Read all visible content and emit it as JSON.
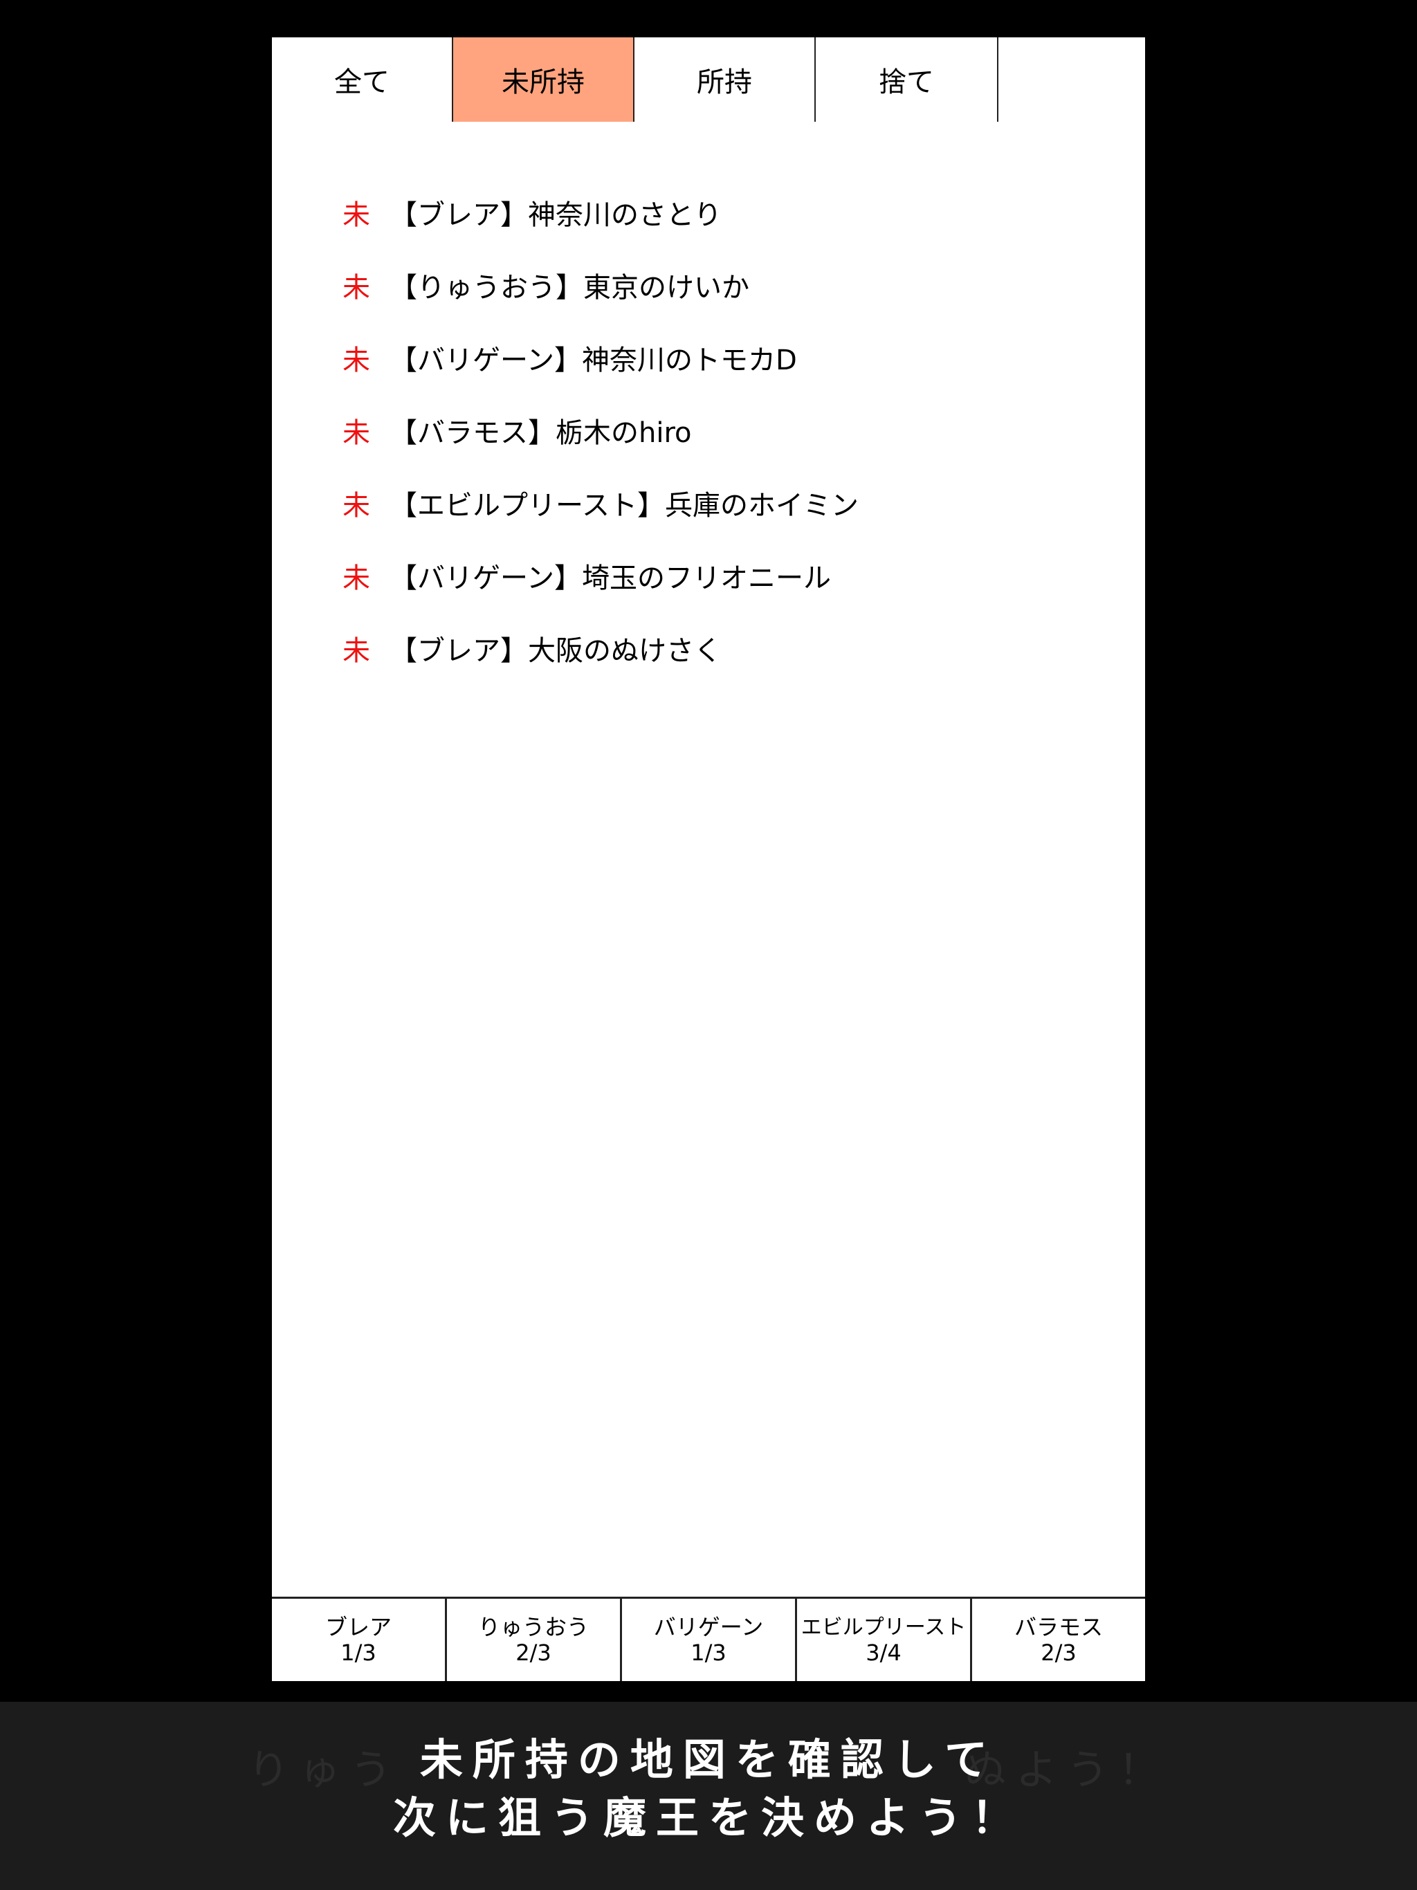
{
  "tabs": [
    {
      "label": "全て",
      "active": false
    },
    {
      "label": "未所持",
      "active": true
    },
    {
      "label": "所持",
      "active": false
    },
    {
      "label": "捨て",
      "active": false
    }
  ],
  "items": [
    {
      "mark": "未",
      "title": "【ブレア】神奈川のさとり"
    },
    {
      "mark": "未",
      "title": "【りゅうおう】東京のけいか"
    },
    {
      "mark": "未",
      "title": "【バリゲーン】神奈川のトモカD"
    },
    {
      "mark": "未",
      "title": "【バラモス】栃木のhiro"
    },
    {
      "mark": "未",
      "title": "【エビルプリースト】兵庫のホイミン"
    },
    {
      "mark": "未",
      "title": "【バリゲーン】埼玉のフリオニール"
    },
    {
      "mark": "未",
      "title": "【ブレア】大阪のぬけさく"
    }
  ],
  "groups": [
    {
      "name": "ブレア",
      "count": "1/3"
    },
    {
      "name": "りゅうおう",
      "count": "2/3"
    },
    {
      "name": "バリゲーン",
      "count": "1/3"
    },
    {
      "name": "エビルプリースト",
      "count": "3/4"
    },
    {
      "name": "バラモス",
      "count": "2/3"
    }
  ],
  "caption": {
    "ghost": "りゅう　　　　　　　　　　　ぬよう！",
    "line1": "未所持の地図を確認して",
    "line2": "次に狙う魔王を決めよう！"
  },
  "colors": {
    "active_tab": "#ffa47e",
    "mark": "#ee1111",
    "caption_bg": "#1c1c1c"
  }
}
